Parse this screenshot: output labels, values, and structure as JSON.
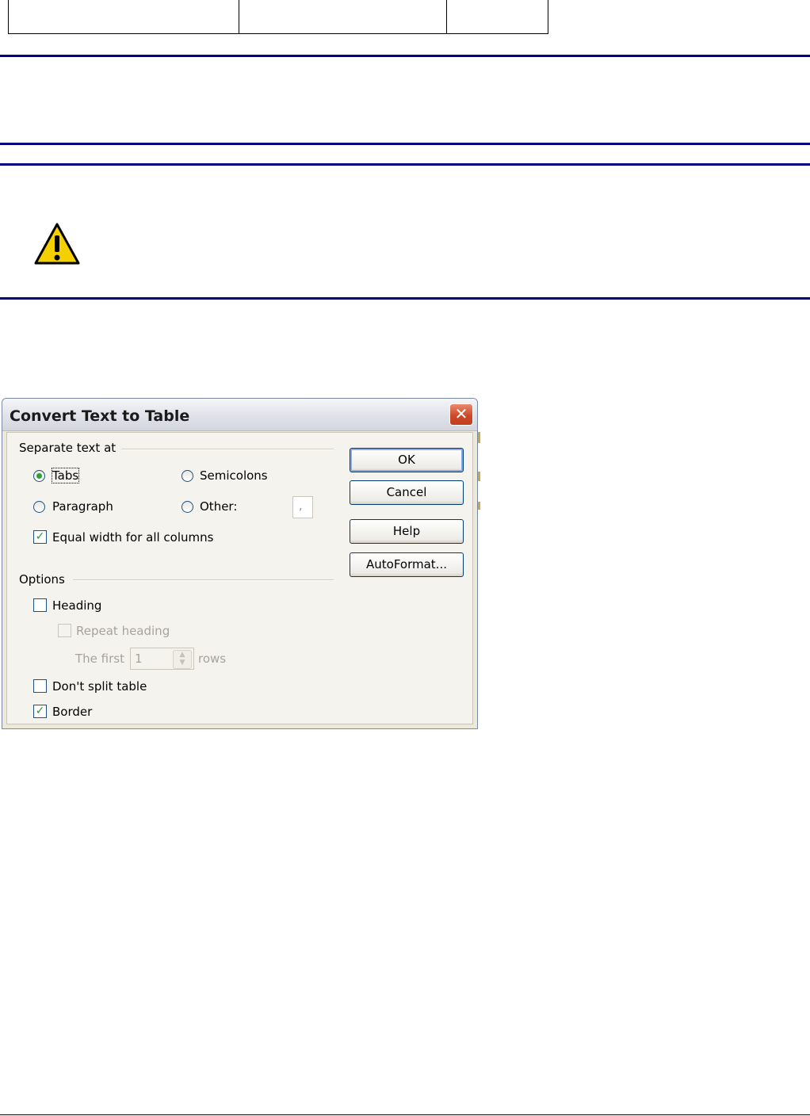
{
  "dialog": {
    "title": "Convert Text to Table",
    "close_glyph": "✕",
    "separate_group": "Separate text at",
    "options_group": "Options",
    "separators": {
      "tabs": "Tabs",
      "semicolons": "Semicolons",
      "paragraph": "Paragraph",
      "other": "Other:",
      "other_value": ",",
      "selected": "tabs"
    },
    "equal_width": {
      "label": "Equal width for all columns",
      "checked": true
    },
    "options": {
      "heading": {
        "label": "Heading",
        "checked": false
      },
      "repeat_heading": {
        "label": "Repeat heading",
        "checked": false,
        "disabled": true
      },
      "the_first": "The first",
      "rows_value": "1",
      "rows": "rows",
      "dont_split": {
        "label": "Don't split table",
        "checked": false
      },
      "border": {
        "label": "Border",
        "checked": true
      }
    },
    "buttons": {
      "ok": "OK",
      "cancel": "Cancel",
      "help": "Help",
      "autoformat": "AutoFormat..."
    },
    "check_glyph": "✓"
  },
  "colors": {
    "rule": "#000080",
    "warning_yellow": "#f5d000",
    "radio_dot": "#2fa035",
    "check": "#21a121"
  },
  "icons": {
    "warning": "warning-triangle-icon"
  }
}
